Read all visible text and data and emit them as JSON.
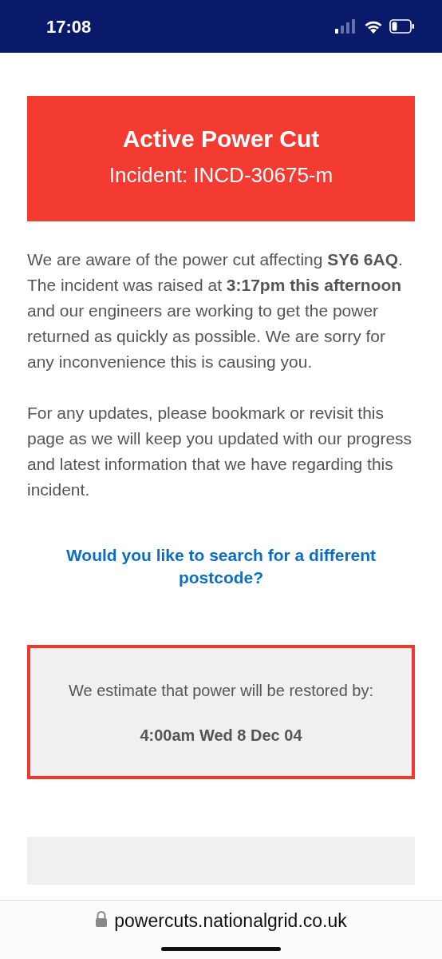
{
  "status_bar": {
    "time": "17:08"
  },
  "banner": {
    "title": "Active Power Cut",
    "incident": "Incident: INCD-30675-m"
  },
  "paragraphs": [
    "We are aware of the power cut affecting **SY6 6AQ**. The incident was raised at **3:17pm this afternoon** and our engineers are working to get the power returned as quickly as possible. We are sorry for any inconvenience this is causing you.",
    "For any updates, please bookmark or revisit this page as we will keep you updated with our progress and latest information that we have regarding this incident."
  ],
  "search_link": "Would you like to search for a different postcode?",
  "estimate": {
    "text": "We estimate that power will be restored by:",
    "time": "4:00am Wed 8 Dec 04"
  },
  "address_bar": {
    "url": "powercuts.nationalgrid.co.uk"
  }
}
